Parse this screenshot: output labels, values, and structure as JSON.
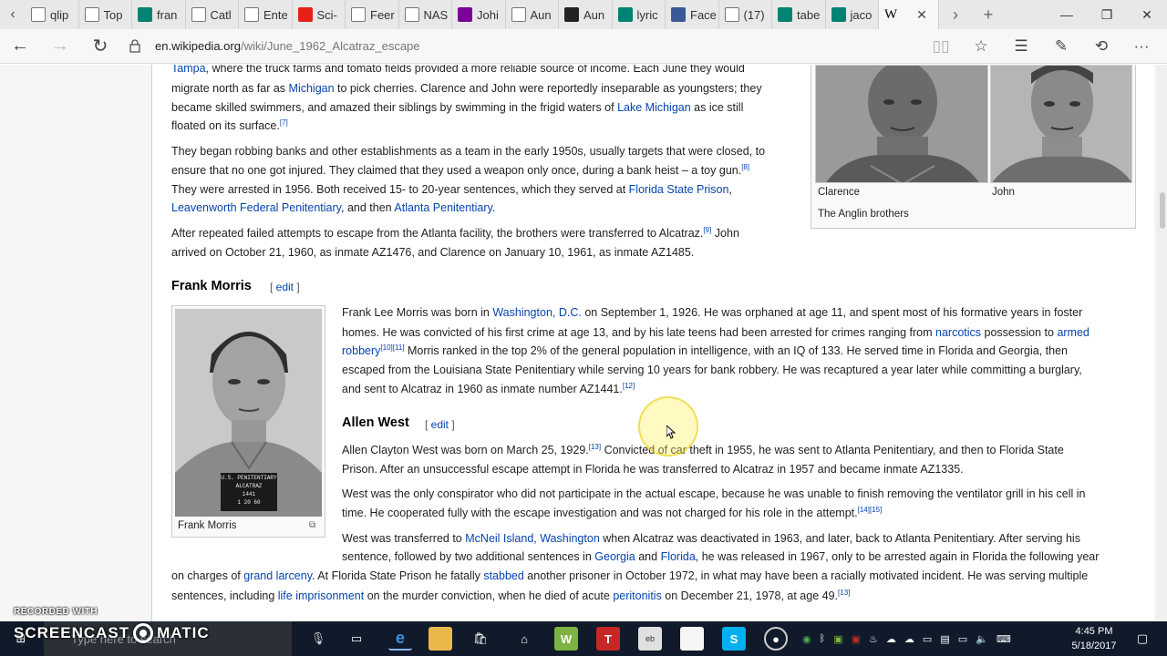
{
  "browser": {
    "tabs": [
      {
        "label": "qlip",
        "icon": "page-icon",
        "color": "#777777"
      },
      {
        "label": "Top",
        "icon": "page-icon",
        "color": "#777777"
      },
      {
        "label": "fran",
        "icon": "bing-icon",
        "color": "#008373"
      },
      {
        "label": "Catl",
        "icon": "page-icon",
        "color": "#777777"
      },
      {
        "label": "Ente",
        "icon": "page-icon",
        "color": "#777777"
      },
      {
        "label": "Sci-",
        "icon": "youtube-icon",
        "color": "#e62117"
      },
      {
        "label": "Feer",
        "icon": "page-icon",
        "color": "#777777"
      },
      {
        "label": "NAS",
        "icon": "page-icon",
        "color": "#777777"
      },
      {
        "label": "Johi",
        "icon": "yahoo-icon",
        "color": "#7b0099"
      },
      {
        "label": "Aun",
        "icon": "page-icon",
        "color": "#777777"
      },
      {
        "label": "Aun",
        "icon": "eye-icon",
        "color": "#222222"
      },
      {
        "label": "lyric",
        "icon": "bing-icon",
        "color": "#008373"
      },
      {
        "label": "Face",
        "icon": "facebook-icon",
        "color": "#3b5998"
      },
      {
        "label": "(17)",
        "icon": "page-icon",
        "color": "#777777"
      },
      {
        "label": "tabe",
        "icon": "bing-icon",
        "color": "#008373"
      },
      {
        "label": "jaco",
        "icon": "bing-icon",
        "color": "#008373"
      }
    ],
    "active_tab": {
      "label": "W",
      "close": "✕"
    },
    "url_domain": "en.wikipedia.org",
    "url_path": "/wiki/June_1962_Alcatraz_escape"
  },
  "article": {
    "p1_l1": {
      "link": "Tampa",
      "text": ", where the truck farms and tomato fields provided a more reliable source of income. Each June they would"
    },
    "p1_l2": {
      "a": "migrate north as far as ",
      "link": "Michigan",
      "b": " to pick cherries. Clarence and John were reportedly inseparable as youngsters; they"
    },
    "p1_l3": {
      "a": "became skilled swimmers, and amazed their siblings by swimming in the frigid waters of ",
      "link": "Lake Michigan",
      "b": " as ice still"
    },
    "p1_l4": {
      "a": "floated on its surface.",
      "sup": "[7]"
    },
    "p2_l1": "They began robbing banks and other establishments as a team in the early 1950s, usually targets that were closed, to",
    "p2_l2": {
      "a": "ensure that no one got injured. They claimed that they used a weapon only once, during a bank heist – a toy gun.",
      "sup": "[8]"
    },
    "p2_l3": {
      "a": "They were arrested in 1956. Both received 15- to 20-year sentences, which they served at ",
      "link": "Florida State Prison",
      "b": ","
    },
    "p2_l4": {
      "link1": "Leavenworth Federal Penitentiary",
      "a": ", and then ",
      "link2": "Atlanta Penitentiary",
      "b": "."
    },
    "p3_l1": {
      "a": "After repeated failed attempts to escape from the Atlanta facility, the brothers were transferred to Alcatraz.",
      "sup": "[9]",
      "b": " John"
    },
    "p3_l2": "arrived on October 21, 1960, as inmate AZ1476, and Clarence on January 10, 1961, as inmate AZ1485.",
    "frank_heading": "Frank Morris",
    "edit_label": "edit",
    "fm_l1": {
      "a": "Frank Lee Morris was born in ",
      "link": "Washington, D.C.",
      "b": " on September 1, 1926. He was orphaned at age 11, and spent most of his formative years in foster"
    },
    "fm_l2": {
      "a": "homes. He was convicted of his first crime at age 13, and by his late teens had been arrested for crimes ranging from ",
      "link1": "narcotics",
      "b": " possession to ",
      "link2": "armed"
    },
    "fm_l3": {
      "link": "robbery",
      "sup": "[10][11]",
      "a": " Morris ranked in the top 2% of the general population in intelligence, with an IQ of 133. He served time in Florida and Georgia, then"
    },
    "fm_l4": "escaped from the Louisiana State Penitentiary while serving 10 years for bank robbery. He was recaptured a year later while committing a burglary,",
    "fm_l5": {
      "a": "and sent to Alcatraz in 1960 as inmate number AZ1441.",
      "sup": "[12]"
    },
    "allen_heading": "Allen West",
    "aw_l1": {
      "a": "Allen Clayton West was born on March 25, 1929.",
      "sup": "[13]",
      "b": " Convicted of car theft in 1955, he was sent to Atlanta Penitentiary, and then to Florida State"
    },
    "aw_l2": "Prison. After an unsuccessful escape attempt in Florida he was transferred to Alcatraz in 1957 and became inmate AZ1335.",
    "aw_l3": "West was the only conspirator who did not participate in the actual escape, because he was unable to finish removing the ventilator grill in his cell in",
    "aw_l4": {
      "a": "time. He cooperated fully with the escape investigation and was not charged for his role in the attempt.",
      "sup": "[14][15]"
    },
    "aw_l5": {
      "a": "West was transferred to ",
      "link1": "McNeil Island, Washington",
      "b": " when Alcatraz was deactivated in 1963, and later, back to Atlanta Penitentiary. After serving his"
    },
    "aw_l6": {
      "a": "sentence, followed by two additional sentences in ",
      "link1": "Georgia",
      "b": " and ",
      "link2": "Florida",
      "c": ", he was released in 1967, only to be arrested again in Florida the following year"
    },
    "aw_l7": {
      "a": "on charges of ",
      "link1": "grand larceny",
      "b": ". At Florida State Prison he fatally ",
      "link2": "stabbed",
      "c": " another prisoner in October 1972, in what may have been a racially motivated incident. He was serving multiple"
    },
    "aw_l8": {
      "a": "sentences, including ",
      "link1": "life imprisonment",
      "b": " on the murder conviction, when he died of acute ",
      "link2": "peritonitis",
      "c": " on December 21, 1978, at age 49.",
      "sup": "[13]"
    },
    "infobox": {
      "caption_left": "Clarence",
      "caption_right": "John",
      "caption": "The Anglin brothers"
    },
    "thumb": {
      "caption": "Frank Morris",
      "sign_line1": "U.S. PENITENTIARY",
      "sign_line2": "ALCATRAZ",
      "sign_line3": "1441",
      "sign_line4": "1 20 60"
    }
  },
  "watermark": {
    "line1": "RECORDED WITH",
    "line2a": "SCREENCAST",
    "line2b": "MATIC"
  },
  "taskbar": {
    "search_placeholder": "Type here to search",
    "time": "4:45 PM",
    "date": "5/18/2017"
  }
}
